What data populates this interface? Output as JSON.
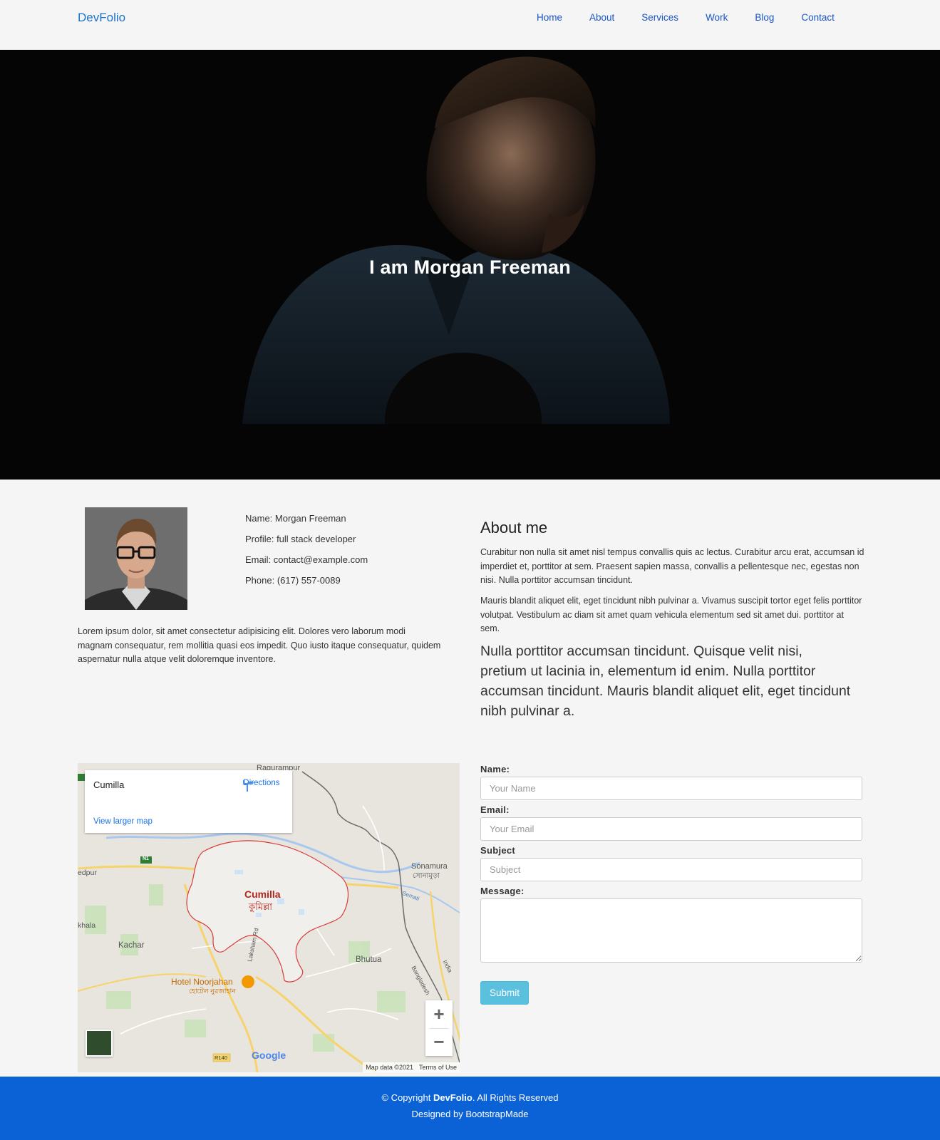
{
  "nav": {
    "brand": "DevFolio",
    "items": [
      {
        "label": "Home"
      },
      {
        "label": "About"
      },
      {
        "label": "Services"
      },
      {
        "label": "Work"
      },
      {
        "label": "Blog"
      },
      {
        "label": "Contact"
      }
    ]
  },
  "hero": {
    "title": "I am Morgan Freeman"
  },
  "profile": {
    "name": "Name: Morgan Freeman",
    "role": "Profile: full stack developer",
    "email": "Email: contact@example.com",
    "phone": "Phone: (617) 557-0089",
    "bio": "Lorem ipsum dolor, sit amet consectetur adipisicing elit. Dolores vero laborum modi magnam consequatur, rem mollitia quasi eos impedit. Quo iusto itaque consequatur, quidem aspernatur nulla atque velit doloremque inventore."
  },
  "about": {
    "title": "About me",
    "p1": "Curabitur non nulla sit amet nisl tempus convallis quis ac lectus. Curabitur arcu erat, accumsan id imperdiet et, porttitor at sem. Praesent sapien massa, convallis a pellentesque nec, egestas non nisi. Nulla porttitor accumsan tincidunt.",
    "p2": "Mauris blandit aliquet elit, eget tincidunt nibh pulvinar a. Vivamus suscipit tortor eget felis porttitor volutpat. Vestibulum ac diam sit amet quam vehicula elementum sed sit amet dui. porttitor at sem.",
    "lead": "Nulla porttitor accumsan tincidunt. Quisque velit nisi, pretium ut lacinia in, elementum id enim. Nulla porttitor accumsan tincidunt. Mauris blandit aliquet elit, eget tincidunt nibh pulvinar a."
  },
  "map": {
    "place": "Cumilla",
    "directions": "Directions",
    "larger": "View larger map",
    "labels": {
      "ragurampur": "Ragurampur",
      "sonamura": "Sonamura",
      "sonamura_bn": "সোনামুড়া",
      "cumilla": "Cumilla",
      "cumilla_bn": "কুমিল্লা",
      "kachar": "Kachar",
      "bhutua": "Bhutua",
      "hotel": "Hotel Noorjahan",
      "hotel_bn": "হোটেল নুরজাহান",
      "lakshamrd": "Laksham Rd",
      "edpur": "edpur",
      "khala": "khala",
      "semati": "Semati",
      "bangladesh": "Bangladesh",
      "india": "India",
      "n1": "N1",
      "r140": "R140"
    },
    "google": "Google",
    "data": "Map data ©2021",
    "terms": "Terms of Use",
    "zoom_in": "+",
    "zoom_out": "−"
  },
  "form": {
    "name_label": "Name:",
    "name_placeholder": "Your Name",
    "email_label": "Email:",
    "email_placeholder": "Your Email",
    "subject_label": "Subject",
    "subject_placeholder": "Subject",
    "message_label": "Message:",
    "submit": "Submit"
  },
  "footer": {
    "copy_prefix": "© Copyright ",
    "copy_brand": "DevFolio",
    "copy_suffix": ". All Rights Reserved",
    "designed": "Designed by BootstrapMade"
  },
  "colors": {
    "brand": "#1a73c9",
    "footer": "#0b62d6",
    "submit": "#5bc0de"
  }
}
